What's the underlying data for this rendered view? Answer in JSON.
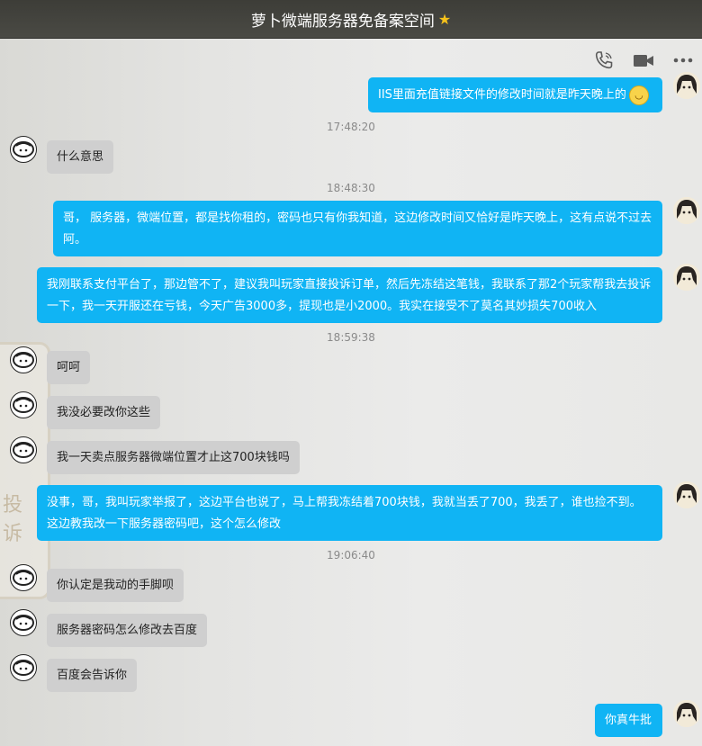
{
  "window": {
    "title": "萝卜微端服务器免备案空间",
    "title_icon": "star-icon"
  },
  "toolbar": {
    "icons": [
      "phone-icon",
      "video-camera-icon",
      "more-icon"
    ]
  },
  "colors": {
    "outgoing_bubble": "#10b4f4",
    "incoming_bubble": "#cfcfcf",
    "titlebar": "#45453f"
  },
  "messages": [
    {
      "side": "out",
      "text": "IIS里面充值链接文件的修改时间就是昨天晚上的",
      "emoji": "sad-face-icon"
    },
    {
      "time": "17:48:20"
    },
    {
      "side": "in",
      "text": "什么意思"
    },
    {
      "time": "18:48:30"
    },
    {
      "side": "out",
      "text": "哥， 服务器，微端位置，都是找你租的，密码也只有你我知道，这边修改时间又恰好是昨天晚上，这有点说不过去阿。"
    },
    {
      "side": "out",
      "text": "我刚联系支付平台了，那边管不了，建议我叫玩家直接投诉订单，然后先冻结这笔钱，我联系了那2个玩家帮我去投诉一下，我一天开服还在亏钱，今天广告3000多，提现也是小2000。我实在接受不了莫名其妙损失700收入"
    },
    {
      "time": "18:59:38"
    },
    {
      "side": "in",
      "text": "呵呵"
    },
    {
      "side": "in",
      "text": "我没必要改你这些"
    },
    {
      "side": "in",
      "text": "我一天卖点服务器微端位置才止这700块钱吗"
    },
    {
      "side": "out",
      "text": "没事，哥，我叫玩家举报了，这边平台也说了，马上帮我冻结着700块钱，我就当丢了700，我丢了，谁也捡不到。这边教我改一下服务器密码吧，这个怎么修改"
    },
    {
      "time": "19:06:40"
    },
    {
      "side": "in",
      "text": "你认定是我动的手脚呗"
    },
    {
      "side": "in",
      "text": "服务器密码怎么修改去百度"
    },
    {
      "side": "in",
      "text": "百度会告诉你"
    },
    {
      "side": "out",
      "text": "你真牛批"
    }
  ]
}
